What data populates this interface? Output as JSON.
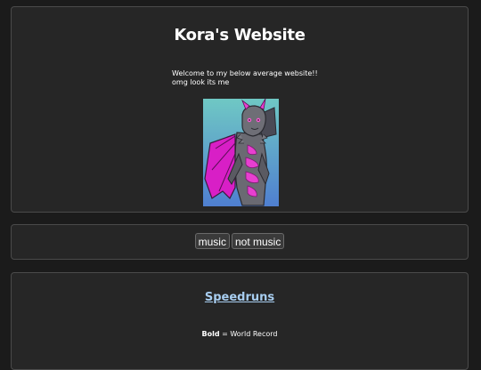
{
  "header": {
    "title": "Kora's Website",
    "welcome_line1": "Welcome to my below average website!!",
    "welcome_line2": "omg look its me",
    "portrait_alt": "dragon-character-portrait"
  },
  "nav": {
    "music_label": "music",
    "not_music_label": "not music"
  },
  "speedruns": {
    "title": "Speedruns",
    "legend_bold": "Bold",
    "legend_rest": " = World Record"
  },
  "colors": {
    "page_bg": "#1b1b1b",
    "panel_bg": "#262626",
    "link": "#a7cdf0",
    "portrait_magenta": "#e020c8",
    "portrait_teal": "#5ab8c0"
  }
}
